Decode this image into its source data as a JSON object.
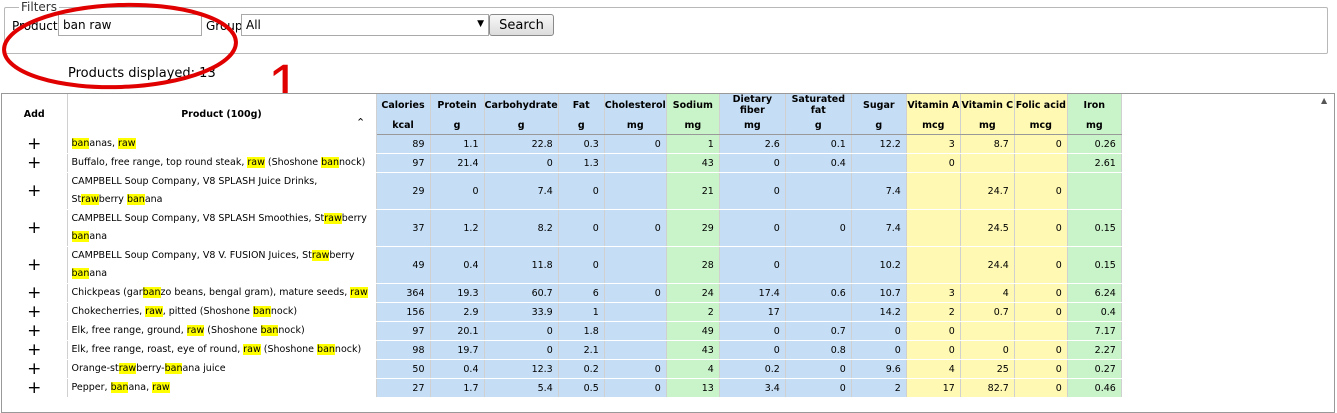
{
  "filter": {
    "legend": "Filters",
    "product_label": "Product:",
    "product_value": "ban raw",
    "group_label": "Group:",
    "group_value": "All",
    "search_label": "Search"
  },
  "products_displayed": "Products displayed: 13",
  "annotation": {
    "number": "1",
    "color": "#e00000"
  },
  "table": {
    "add_header": "Add",
    "product_header": "Product (100g)",
    "columns": [
      {
        "name": "Calories",
        "unit": "kcal",
        "group": "blue"
      },
      {
        "name": "Protein",
        "unit": "g",
        "group": "blue"
      },
      {
        "name": "Carbohydrate",
        "unit": "g",
        "group": "blue"
      },
      {
        "name": "Fat",
        "unit": "g",
        "group": "blue"
      },
      {
        "name": "Cholesterol",
        "unit": "mg",
        "group": "blue"
      },
      {
        "name": "Sodium",
        "unit": "mg",
        "group": "green"
      },
      {
        "name": "Dietary fiber",
        "unit": "mg",
        "group": "blue"
      },
      {
        "name": "Saturated fat",
        "unit": "g",
        "group": "blue"
      },
      {
        "name": "Sugar",
        "unit": "g",
        "group": "blue"
      },
      {
        "name": "Vitamin A",
        "unit": "mcg",
        "group": "yellow"
      },
      {
        "name": "Vitamin C",
        "unit": "mg",
        "group": "yellow"
      },
      {
        "name": "Folic acid",
        "unit": "mcg",
        "group": "yellow"
      },
      {
        "name": "Iron",
        "unit": "mg",
        "group": "green"
      }
    ],
    "rows": [
      {
        "name": [
          [
            "ban",
            1
          ],
          [
            "anas, ",
            0
          ],
          [
            "raw",
            1
          ]
        ],
        "values": [
          "89",
          "1.1",
          "22.8",
          "0.3",
          "0",
          "1",
          "2.6",
          "0.1",
          "12.2",
          "3",
          "8.7",
          "0",
          "0.26"
        ]
      },
      {
        "name": [
          [
            "Buffalo, free range, top round steak, ",
            0
          ],
          [
            "raw",
            1
          ],
          [
            " (Shoshone ",
            0
          ],
          [
            "ban",
            1
          ],
          [
            "nock)",
            0
          ]
        ],
        "values": [
          "97",
          "21.4",
          "0",
          "1.3",
          "",
          "43",
          "0",
          "0.4",
          "",
          "0",
          "",
          "",
          "2.61"
        ]
      },
      {
        "name": [
          [
            "CAMPBELL Soup Company, V8 SPLASH Juice Drinks, St",
            0
          ],
          [
            "raw",
            1
          ],
          [
            "berry ",
            0
          ],
          [
            "ban",
            1
          ],
          [
            "ana",
            0
          ]
        ],
        "values": [
          "29",
          "0",
          "7.4",
          "0",
          "",
          "21",
          "0",
          "",
          "7.4",
          "",
          "24.7",
          "0",
          ""
        ]
      },
      {
        "name": [
          [
            "CAMPBELL Soup Company, V8 SPLASH Smoothies, St",
            0
          ],
          [
            "raw",
            1
          ],
          [
            "berry ",
            0
          ],
          [
            "ban",
            1
          ],
          [
            "ana",
            0
          ]
        ],
        "values": [
          "37",
          "1.2",
          "8.2",
          "0",
          "0",
          "29",
          "0",
          "0",
          "7.4",
          "",
          "24.5",
          "0",
          "0.15"
        ]
      },
      {
        "name": [
          [
            "CAMPBELL Soup Company, V8 V. FUSION Juices, St",
            0
          ],
          [
            "raw",
            1
          ],
          [
            "berry ",
            0
          ],
          [
            "ban",
            1
          ],
          [
            "ana",
            0
          ]
        ],
        "values": [
          "49",
          "0.4",
          "11.8",
          "0",
          "",
          "28",
          "0",
          "",
          "10.2",
          "",
          "24.4",
          "0",
          "0.15"
        ]
      },
      {
        "name": [
          [
            "Chickpeas (gar",
            0
          ],
          [
            "ban",
            1
          ],
          [
            "zo beans, bengal gram), mature seeds, ",
            0
          ],
          [
            "raw",
            1
          ]
        ],
        "values": [
          "364",
          "19.3",
          "60.7",
          "6",
          "0",
          "24",
          "17.4",
          "0.6",
          "10.7",
          "3",
          "4",
          "0",
          "6.24"
        ]
      },
      {
        "name": [
          [
            "Chokecherries, ",
            0
          ],
          [
            "raw",
            1
          ],
          [
            ", pitted (Shoshone ",
            0
          ],
          [
            "ban",
            1
          ],
          [
            "nock)",
            0
          ]
        ],
        "values": [
          "156",
          "2.9",
          "33.9",
          "1",
          "",
          "2",
          "17",
          "",
          "14.2",
          "2",
          "0.7",
          "0",
          "0.4"
        ]
      },
      {
        "name": [
          [
            "Elk, free range, ground, ",
            0
          ],
          [
            "raw",
            1
          ],
          [
            " (Shoshone ",
            0
          ],
          [
            "ban",
            1
          ],
          [
            "nock)",
            0
          ]
        ],
        "values": [
          "97",
          "20.1",
          "0",
          "1.8",
          "",
          "49",
          "0",
          "0.7",
          "0",
          "0",
          "",
          "",
          "7.17"
        ]
      },
      {
        "name": [
          [
            "Elk, free range, roast, eye of round, ",
            0
          ],
          [
            "raw",
            1
          ],
          [
            " (Shoshone ",
            0
          ],
          [
            "ban",
            1
          ],
          [
            "nock)",
            0
          ]
        ],
        "values": [
          "98",
          "19.7",
          "0",
          "2.1",
          "",
          "43",
          "0",
          "0.8",
          "0",
          "0",
          "0",
          "0",
          "2.27"
        ]
      },
      {
        "name": [
          [
            "Orange-st",
            0
          ],
          [
            "raw",
            1
          ],
          [
            "berry-",
            0
          ],
          [
            "ban",
            1
          ],
          [
            "ana juice",
            0
          ]
        ],
        "values": [
          "50",
          "0.4",
          "12.3",
          "0.2",
          "0",
          "4",
          "0.2",
          "0",
          "9.6",
          "4",
          "25",
          "0",
          "0.27"
        ]
      },
      {
        "name": [
          [
            "Pepper, ",
            0
          ],
          [
            "ban",
            1
          ],
          [
            "ana, ",
            0
          ],
          [
            "raw",
            1
          ]
        ],
        "values": [
          "27",
          "1.7",
          "5.4",
          "0.5",
          "0",
          "13",
          "3.4",
          "0",
          "2",
          "17",
          "82.7",
          "0",
          "0.46"
        ]
      }
    ]
  }
}
